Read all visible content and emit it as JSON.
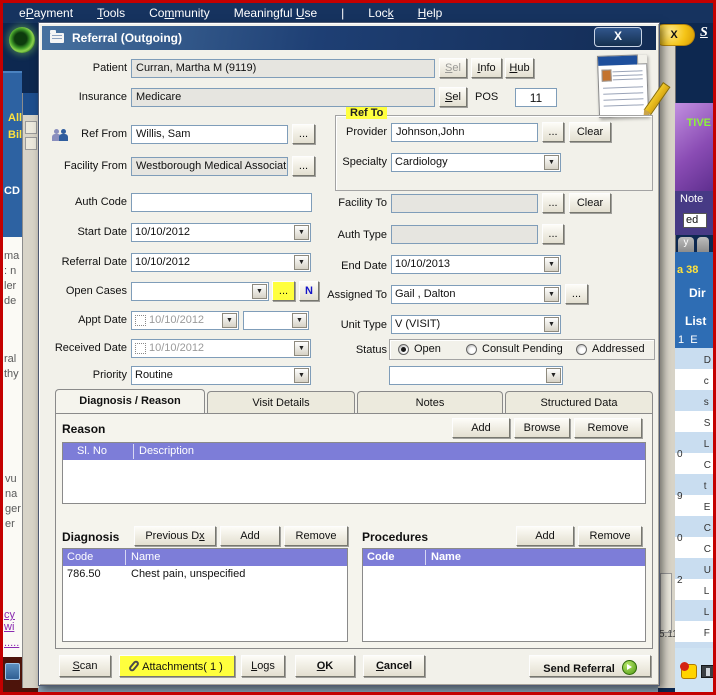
{
  "menu": {
    "items": [
      {
        "pre": "e",
        "u": "P",
        "post": "ayment"
      },
      {
        "pre": "",
        "u": "T",
        "post": "ools"
      },
      {
        "pre": "Co",
        "u": "m",
        "post": "munity"
      },
      {
        "pre": "Meaningful ",
        "u": "U",
        "post": "se"
      },
      {
        "pre": "Loc",
        "u": "k",
        "post": ""
      },
      {
        "pre": "",
        "u": "H",
        "post": "elp"
      }
    ],
    "separator": "|"
  },
  "background": {
    "top_right": {
      "close_x": "X",
      "s_link": "S"
    },
    "left": {
      "label_all": "All",
      "label_bil": "Bil",
      "label_cd": "CD",
      "fragments_a": "ma\n: n\nler\nde",
      "fragments_b": "ral\nthy",
      "fragments_c": "vu\nna\nger\ner",
      "link_a": "cy wi",
      "link_b": "....."
    },
    "right": {
      "tive": "TIVE",
      "note": "Note",
      "ed": "ed",
      "tab_y": "y",
      "a38": "a 38",
      "dir": "Dir",
      "list": "List",
      "blue_row": "1  E",
      "row_fragments": "D\nc\ns\nS\nL\nC\nt\nE\nC\nC\nU\nL\nL\nF",
      "digit_fragments": "0\n9\n0\n2",
      "version": "5.11"
    }
  },
  "dialog": {
    "title": "Referral (Outgoing)",
    "close_x": "X",
    "header": {
      "patient_label": "Patient",
      "patient_value": "Curran, Martha M  (9119)",
      "sel_disabled": {
        "pre": "",
        "u": "S",
        "post": "el"
      },
      "info": {
        "pre": "",
        "u": "I",
        "post": "nfo"
      },
      "hub": {
        "pre": "",
        "u": "H",
        "post": "ub"
      },
      "insurance_label": "Insurance",
      "insurance_value": "Medicare",
      "sel": {
        "pre": "",
        "u": "S",
        "post": "el"
      },
      "pos_label": "POS",
      "pos_value": "11"
    },
    "form": {
      "ref_from_label": "Ref From",
      "ref_from_value": "Willis, Sam",
      "facility_from_label": "Facility From",
      "facility_from_value": "Westborough Medical Associat",
      "auth_code_label": "Auth Code",
      "auth_code_value": "",
      "start_date_label": "Start Date",
      "start_date_value": "10/10/2012",
      "referral_date_label": "Referral Date",
      "referral_date_value": "10/10/2012",
      "open_cases_label": "Open Cases",
      "open_cases_value": "",
      "n_button": "N",
      "appt_date_label": "Appt Date",
      "appt_date_value": "10/10/2012",
      "appt_extra_value": "",
      "received_date_label": "Received Date",
      "received_date_value": "10/10/2012",
      "priority_label": "Priority",
      "priority_value": "Routine",
      "ellipsis": "...",
      "ref_to_legend": "Ref To",
      "provider_label": "Provider",
      "provider_value": "Johnson,John",
      "specialty_label": "Specialty",
      "specialty_value": "Cardiology",
      "clear_label": "Clear",
      "facility_to_label": "Facility To",
      "facility_to_value": "",
      "auth_type_label": "Auth Type",
      "auth_type_value": "",
      "end_date_label": "End Date",
      "end_date_value": "10/10/2013",
      "assigned_to_label": "Assigned To",
      "assigned_to_value": "Gail , Dalton",
      "unit_type_label": "Unit Type",
      "unit_type_value": "V (VISIT)",
      "status_label": "Status",
      "status_options": [
        {
          "label": "Open",
          "selected": true
        },
        {
          "label": "Consult Pending",
          "selected": false
        },
        {
          "label": "Addressed",
          "selected": false
        }
      ],
      "status_extra_value": ""
    },
    "tabs": [
      {
        "label": "Diagnosis / Reason",
        "active": true
      },
      {
        "label": "Visit Details",
        "active": false
      },
      {
        "label": "Notes",
        "active": false
      },
      {
        "label": "Structured Data",
        "active": false
      }
    ],
    "reason": {
      "title": "Reason",
      "add": "Add",
      "browse": "Browse",
      "remove": "Remove",
      "col_slno": "Sl. No",
      "col_desc": "Description",
      "rows": []
    },
    "diagnosis": {
      "title": "Diagnosis",
      "previous_dx": {
        "pre": "Previous D",
        "u": "x",
        "post": ""
      },
      "add": "Add",
      "remove": "Remove",
      "col_code": "Code",
      "col_name": "Name",
      "rows": [
        {
          "code": "786.50",
          "name": "Chest pain, unspecified"
        }
      ]
    },
    "procedures": {
      "title": "Procedures",
      "add": "Add",
      "remove": "Remove",
      "col_code": "Code",
      "col_name": "Name",
      "rows": []
    },
    "footer": {
      "scan": {
        "pre": "",
        "u": "S",
        "post": "can"
      },
      "attachments": "Attachments( 1 )",
      "logs": {
        "pre": "",
        "u": "L",
        "post": "ogs"
      },
      "ok": {
        "pre": "",
        "u": "O",
        "post": "K"
      },
      "cancel": {
        "pre": "",
        "u": "C",
        "post": "ancel"
      },
      "send_referral": "Send Referral"
    },
    "colors": {
      "accent_yellow": "#ffff3f",
      "grid_header": "#7d7dd8",
      "title_bar": "#1e3f74"
    }
  }
}
